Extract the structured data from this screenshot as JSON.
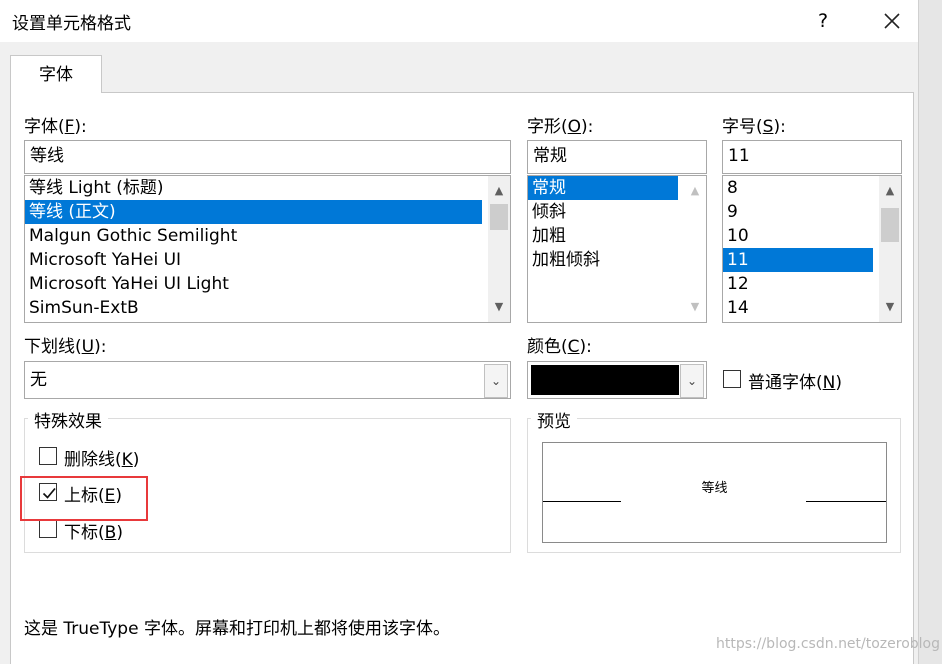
{
  "dialog": {
    "title": "设置单元格格式",
    "help": "?",
    "close_icon": "close-icon"
  },
  "tabs": [
    {
      "label": "字体"
    }
  ],
  "font": {
    "label": "字体(",
    "key": "F",
    "label_end": "):",
    "value": "等线",
    "items": [
      "等线 Light (标题)",
      "等线 (正文)",
      "Malgun Gothic Semilight",
      "Microsoft YaHei UI",
      "Microsoft YaHei UI Light",
      "SimSun-ExtB"
    ],
    "selected": 1
  },
  "style": {
    "label": "字形(",
    "key": "O",
    "label_end": "):",
    "value": "常规",
    "items": [
      "常规",
      "倾斜",
      "加粗",
      "加粗倾斜"
    ],
    "selected": 0
  },
  "size": {
    "label": "字号(",
    "key": "S",
    "label_end": "):",
    "value": "11",
    "items": [
      "8",
      "9",
      "10",
      "11",
      "12",
      "14"
    ],
    "selected": 3
  },
  "underline": {
    "label": "下划线(",
    "key": "U",
    "label_end": "):",
    "value": "无"
  },
  "color": {
    "label": "颜色(",
    "key": "C",
    "label_end": "):",
    "swatch": "#000000"
  },
  "normal_font": {
    "label": "普通字体(",
    "key": "N",
    "label_end": ")",
    "checked": false
  },
  "effects": {
    "title": "特殊效果",
    "strikethrough": {
      "label": "删除线(",
      "key": "K",
      "label_end": ")",
      "checked": false
    },
    "superscript": {
      "label": "上标(",
      "key": "E",
      "label_end": ")",
      "checked": true
    },
    "subscript": {
      "label": "下标(",
      "key": "B",
      "label_end": ")",
      "checked": false
    }
  },
  "preview": {
    "title": "预览",
    "sample": "等线"
  },
  "info_text": "这是 TrueType 字体。屏幕和打印机上都将使用该字体。",
  "watermark": "https://blog.csdn.net/tozeroblog",
  "colors": {
    "selection": "#0078d7",
    "highlight_box": "#e8393b"
  }
}
